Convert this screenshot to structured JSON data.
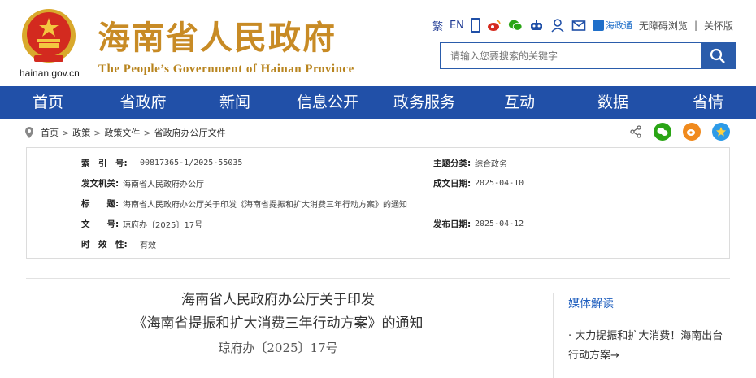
{
  "header": {
    "site_url": "hainan.gov.cn",
    "site_name_cn": "海南省人民政府",
    "site_name_en": "The People’s Government  of Hainan Province",
    "toplinks": {
      "traditional": "繁",
      "english": "EN",
      "zhengtong": "海政通",
      "accessible": "无障碍浏览",
      "divider": "|",
      "care": "关怀版"
    },
    "icons": [
      "phone-icon",
      "weibo-icon",
      "wechat-icon",
      "robot-icon",
      "user-icon",
      "mail-icon"
    ],
    "search": {
      "placeholder": "请输入您要搜索的关键字"
    }
  },
  "nav": {
    "items": [
      "首页",
      "省政府",
      "新闻",
      "信息公开",
      "政务服务",
      "互动",
      "数据",
      "省情"
    ]
  },
  "breadcrumb": {
    "items": [
      "首页",
      "政策",
      "政策文件",
      "省政府办公厅文件"
    ],
    "separator": ">"
  },
  "meta": {
    "index_label": "索　引　号:",
    "index_value": "00817365-1/2025-55035",
    "category_label": "主题分类:",
    "category_value": "综合政务",
    "issuer_label": "发文机关:",
    "issuer_value": "海南省人民政府办公厅",
    "date_made_label": "成文日期:",
    "date_made_value": "2025-04-10",
    "title_label": "标　　题:",
    "title_value": "海南省人民政府办公厅关于印发《海南省提振和扩大消费三年行动方案》的通知",
    "docno_label": "文　　号:",
    "docno_value": "琼府办〔2025〕17号",
    "pub_date_label": "发布日期:",
    "pub_date_value": "2025-04-12",
    "validity_label": "时　效　性:",
    "validity_value": "有效"
  },
  "article": {
    "title_line1": "海南省人民政府办公厅关于印发",
    "title_line2": "《海南省提振和扩大消费三年行动方案》的通知",
    "doc_number": "琼府办〔2025〕17号"
  },
  "side": {
    "title": "媒体解读",
    "items": [
      "· 大力提振和扩大消费！海南出台行动方案→"
    ]
  },
  "colors": {
    "nav_bg": "#2150a8",
    "title_gold": "#c88b25",
    "link_blue": "#2160bf"
  }
}
